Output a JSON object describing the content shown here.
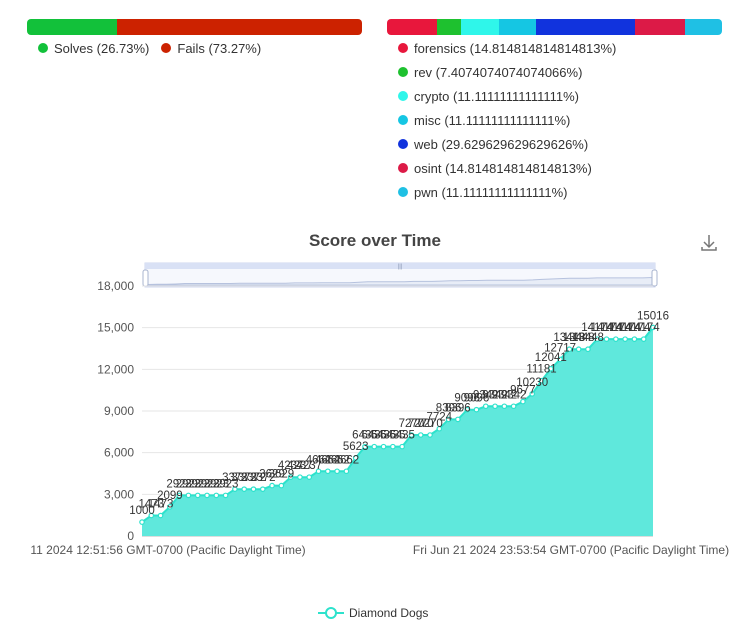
{
  "solves_chart": {
    "segments": [
      {
        "label": "Solves",
        "percent": 26.73,
        "color": "#12c13a",
        "legend": "Solves (26.73%)"
      },
      {
        "label": "Fails",
        "percent": 73.27,
        "color": "#cc2200",
        "legend": "Fails (73.27%)"
      }
    ]
  },
  "category_chart": {
    "segments": [
      {
        "label": "forensics",
        "percent": 14.814814814814813,
        "color": "#e8173c",
        "legend": "forensics (14.814814814814813%)"
      },
      {
        "label": "rev",
        "percent": 7.4074074074074066,
        "color": "#1ec12f",
        "legend": "rev (7.4074074074074066%)"
      },
      {
        "label": "crypto",
        "percent": 11.11111111111111,
        "color": "#2ff6ea",
        "legend": "crypto (11.11111111111111%)"
      },
      {
        "label": "misc",
        "percent": 11.11111111111111,
        "color": "#15c6e3",
        "legend": "misc (11.11111111111111%)"
      },
      {
        "label": "web",
        "percent": 29.629629629629626,
        "color": "#1133dd",
        "legend": "web (29.629629629629626%)"
      },
      {
        "label": "osint",
        "percent": 14.814814814814813,
        "color": "#dc1a47",
        "legend": "osint (14.814814814814813%)"
      },
      {
        "label": "pwn",
        "percent": 11.11111111111111,
        "color": "#1fc0e4",
        "legend": "pwn (11.11111111111111%)"
      }
    ]
  },
  "chart_data": {
    "type": "area",
    "title": "Score over Time",
    "x_tick_labels": [
      "11 2024 12:51:56 GMT-0700 (Pacific Daylight Time)",
      "Fri Jun 21 2024 23:53:54 GMT-0700 (Pacific Daylight Time)"
    ],
    "y_ticks": [
      "0",
      "3,000",
      "6,000",
      "9,000",
      "12,000",
      "15,000",
      "18,000"
    ],
    "ylim": [
      0,
      18000
    ],
    "series": [
      {
        "name": "Diamond Dogs",
        "color": "#2de2cc",
        "values": [
          1000,
          1473,
          1473,
          2099,
          2923,
          2923,
          2923,
          2923,
          2923,
          2923,
          3372,
          3372,
          3372,
          3372,
          3629,
          3629,
          4237,
          4237,
          4237,
          4662,
          4662,
          4662,
          4662,
          5623,
          6435,
          6435,
          6435,
          6435,
          6435,
          7270,
          7270,
          7270,
          7724,
          8396,
          8396,
          9096,
          9096,
          9342,
          9342,
          9342,
          9342,
          9677,
          10230,
          11181,
          12041,
          12717,
          13448,
          13448,
          13448,
          14174,
          14174,
          14174,
          14174,
          14174,
          14174,
          15016
        ]
      }
    ],
    "data_labels": [
      {
        "i": 0,
        "text": "1000"
      },
      {
        "i": 1,
        "text": "1473"
      },
      {
        "i": 2,
        "text": "1473"
      },
      {
        "i": 3,
        "text": "2099"
      },
      {
        "i": 4,
        "text": "2923"
      },
      {
        "i": 5,
        "text": "2923"
      },
      {
        "i": 6,
        "text": "2923"
      },
      {
        "i": 7,
        "text": "2923"
      },
      {
        "i": 8,
        "text": "2923"
      },
      {
        "i": 9,
        "text": "2923"
      },
      {
        "i": 10,
        "text": "3372"
      },
      {
        "i": 11,
        "text": "3372"
      },
      {
        "i": 12,
        "text": "3372"
      },
      {
        "i": 13,
        "text": "3372"
      },
      {
        "i": 14,
        "text": "3629"
      },
      {
        "i": 15,
        "text": "3629"
      },
      {
        "i": 16,
        "text": "4237"
      },
      {
        "i": 17,
        "text": "4237"
      },
      {
        "i": 18,
        "text": "4237"
      },
      {
        "i": 19,
        "text": "4662"
      },
      {
        "i": 20,
        "text": "4662"
      },
      {
        "i": 21,
        "text": "4662"
      },
      {
        "i": 22,
        "text": "4662"
      },
      {
        "i": 23,
        "text": "5623"
      },
      {
        "i": 24,
        "text": "6435"
      },
      {
        "i": 25,
        "text": "6435"
      },
      {
        "i": 26,
        "text": "6435"
      },
      {
        "i": 27,
        "text": "6435"
      },
      {
        "i": 28,
        "text": "6435"
      },
      {
        "i": 29,
        "text": "7270"
      },
      {
        "i": 30,
        "text": "7270"
      },
      {
        "i": 31,
        "text": "7270"
      },
      {
        "i": 32,
        "text": "7724"
      },
      {
        "i": 33,
        "text": "8396"
      },
      {
        "i": 34,
        "text": "8396"
      },
      {
        "i": 35,
        "text": "9096"
      },
      {
        "i": 36,
        "text": "9096"
      },
      {
        "i": 37,
        "text": "9342"
      },
      {
        "i": 38,
        "text": "9342"
      },
      {
        "i": 39,
        "text": "9342"
      },
      {
        "i": 40,
        "text": "9342"
      },
      {
        "i": 41,
        "text": "9677"
      },
      {
        "i": 42,
        "text": "10230"
      },
      {
        "i": 43,
        "text": "11181"
      },
      {
        "i": 44,
        "text": "12041"
      },
      {
        "i": 45,
        "text": "12717"
      },
      {
        "i": 46,
        "text": "13448"
      },
      {
        "i": 47,
        "text": "13448"
      },
      {
        "i": 48,
        "text": "13448"
      },
      {
        "i": 49,
        "text": "14174"
      },
      {
        "i": 50,
        "text": "14174"
      },
      {
        "i": 51,
        "text": "14174"
      },
      {
        "i": 52,
        "text": "14174"
      },
      {
        "i": 53,
        "text": "14174"
      },
      {
        "i": 54,
        "text": "14174"
      },
      {
        "i": 55,
        "text": "15016"
      }
    ],
    "legend": "Diamond Dogs",
    "grid": true,
    "legend_position": "bottom-center"
  },
  "icons": {
    "download": "download-icon"
  }
}
